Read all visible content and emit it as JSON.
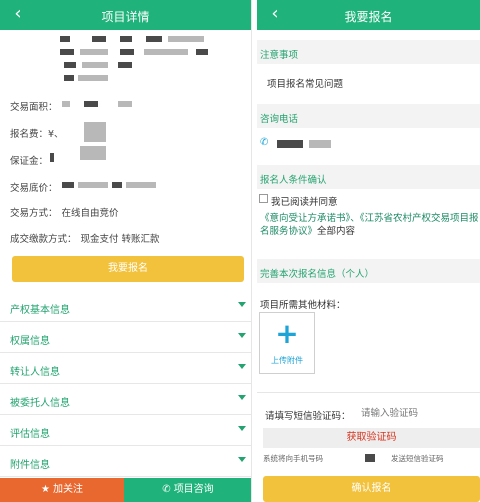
{
  "left": {
    "title": "项目详情",
    "fields": {
      "area_label": "交易面积：",
      "fee_label": "报名费：",
      "fee_prefix": "¥、",
      "deposit_label": "保证金：",
      "floor_label": "交易底价：",
      "method_label": "交易方式：",
      "method_value": "在线自由竞价",
      "payment_label": "成交缴款方式：",
      "payment_value": "现金支付  转账汇款"
    },
    "signup_button": "我要报名",
    "sections": [
      "产权基本信息",
      "权属信息",
      "转让人信息",
      "被委托人信息",
      "评估信息",
      "附件信息"
    ],
    "follow_button": "加关注",
    "consult_button": "项目咨询"
  },
  "right": {
    "title": "我要报名",
    "notice_header": "注意事项",
    "faq_link": "项目报名常见问题",
    "phone_header": "咨询电话",
    "confirm_header": "报名人条件确认",
    "agree_label": "我已阅读并同意",
    "agreement_link": "《意向受让方承诺书》、《江苏省农村产权交易项目报名服务协议》",
    "agreement_suffix": "全部内容",
    "complete_header": "完善本次报名信息（个人）",
    "materials_label": "项目所需其他材料：",
    "upload_label": "上传附件",
    "sms_label": "请填写短信验证码：",
    "sms_placeholder": "请输入验证码",
    "get_code_button": "获取验证码",
    "send_note_pre": "系统将向手机号码",
    "send_note_post": "发送短信验证码",
    "confirm_button": "确认报名"
  },
  "colors": {
    "green": "#1fb27a",
    "yellow": "#f3c23c",
    "orange": "#e8682f",
    "red": "#d9341f"
  },
  "icons": [
    "back-arrow",
    "chevron-down",
    "star",
    "phone",
    "plus",
    "checkbox"
  ]
}
